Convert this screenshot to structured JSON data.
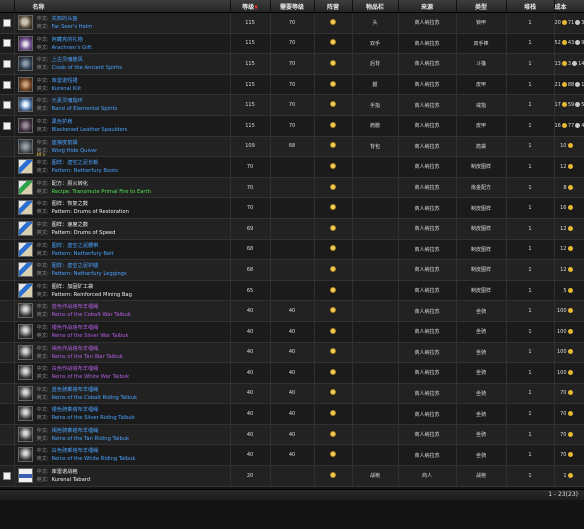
{
  "columns": {
    "name": "名称",
    "level": "等级",
    "req_level": "需要等级",
    "faction": "阵营",
    "slot": "物品栏",
    "source": "来源",
    "type": "类型",
    "stack": "堆栈",
    "cost": "成本"
  },
  "labels": {
    "cn": "中文:",
    "en": "英文:"
  },
  "rows": [
    {
      "icon": "helm",
      "quality": "rare",
      "checkbox": true,
      "cn": "先知的头盔",
      "en": "Far Seer's Helm",
      "level": "115",
      "req": "70",
      "slot": "头",
      "source": "商人纳拉苏",
      "type": "锁甲",
      "stack": "1",
      "cost": {
        "g": "20",
        "s": "71",
        "c": "31"
      }
    },
    {
      "icon": "gift",
      "quality": "rare",
      "checkbox": true,
      "cn": "阿藏克的礼物",
      "en": "Arachnen's Gift",
      "level": "115",
      "req": "70",
      "slot": "双手",
      "source": "商人纳拉苏",
      "type": "双手棒",
      "stack": "1",
      "cost": {
        "g": "52",
        "s": "43",
        "c": "92"
      }
    },
    {
      "icon": "cloak",
      "quality": "rare",
      "checkbox": true,
      "cn": "上古灵魂披风",
      "en": "Cloak of the Ancient Spirits",
      "level": "115",
      "req": "70",
      "slot": "后背",
      "source": "商人纳拉苏",
      "type": "斗篷",
      "stack": "1",
      "cost": {
        "g": "13",
        "s": "3",
        "c": "14"
      }
    },
    {
      "icon": "kilt",
      "quality": "rare",
      "checkbox": true,
      "cn": "库雷诺短裙",
      "en": "Kurenal Kilt",
      "level": "115",
      "req": "70",
      "slot": "腿",
      "source": "商人纳拉苏",
      "type": "皮甲",
      "stack": "1",
      "cost": {
        "g": "21",
        "s": "88",
        "c": "18"
      }
    },
    {
      "icon": "band",
      "quality": "rare",
      "checkbox": true,
      "cn": "元素灵魂指环",
      "en": "Band of Elemental Spirits",
      "level": "115",
      "req": "70",
      "slot": "手指",
      "source": "商人纳拉苏",
      "type": "戒指",
      "stack": "1",
      "cost": {
        "g": "17",
        "s": "59",
        "c": "52"
      }
    },
    {
      "icon": "spauld",
      "quality": "rare",
      "checkbox": true,
      "cn": "黑色护肩",
      "en": "Blackened Leather Spaulders",
      "level": "115",
      "req": "70",
      "slot": "肩膀",
      "source": "商人纳拉苏",
      "type": "皮甲",
      "stack": "1",
      "cost": {
        "g": "16",
        "s": "77",
        "c": "43"
      }
    },
    {
      "icon": "quiver",
      "quality": "rare",
      "checkbox": false,
      "cn": "座狼皮箭袋",
      "en": "Worg Hide Quiver",
      "note": "猎人",
      "level": "109",
      "req": "68",
      "slot": "背包",
      "source": "商人纳拉苏",
      "type": "箭袋",
      "stack": "1",
      "cost": {
        "g": "10",
        "s": "",
        "c": ""
      }
    },
    {
      "icon": "pattern",
      "quality": "rare",
      "checkbox": false,
      "cn": "图样：虚空之泥长靴",
      "en": "Pattern: Netherfury Boots",
      "level": "70",
      "req": "",
      "slot": "",
      "source": "商人纳拉苏",
      "type": "制皮图样",
      "stack": "1",
      "cost": {
        "g": "12",
        "s": "",
        "c": ""
      }
    },
    {
      "icon": "recipe",
      "quality": "green",
      "checkbox": false,
      "cn": "配方：原火转化",
      "en": "Recipe: Transmute Primal Fire to Earth",
      "level": "70",
      "req": "",
      "slot": "",
      "source": "商人纳拉苏",
      "type": "炼金配方",
      "stack": "1",
      "cost": {
        "g": "8",
        "s": "",
        "c": ""
      }
    },
    {
      "icon": "pattern",
      "quality": "white",
      "checkbox": false,
      "cn": "图样：恢复之鼓",
      "en": "Pattern: Drums of Restoration",
      "level": "70",
      "req": "",
      "slot": "",
      "source": "商人纳拉苏",
      "type": "制皮图样",
      "stack": "1",
      "cost": {
        "g": "16",
        "s": "",
        "c": ""
      }
    },
    {
      "icon": "pattern",
      "quality": "white",
      "checkbox": false,
      "cn": "图样：速度之鼓",
      "en": "Pattern: Drums of Speed",
      "level": "69",
      "req": "",
      "slot": "",
      "source": "商人纳拉苏",
      "type": "制皮图样",
      "stack": "1",
      "cost": {
        "g": "12",
        "s": "",
        "c": ""
      }
    },
    {
      "icon": "pattern",
      "quality": "rare",
      "checkbox": false,
      "cn": "图样：虚空之泥腰带",
      "en": "Pattern: Netherfury Belt",
      "level": "68",
      "req": "",
      "slot": "",
      "source": "商人纳拉苏",
      "type": "制皮图样",
      "stack": "1",
      "cost": {
        "g": "12",
        "s": "",
        "c": ""
      }
    },
    {
      "icon": "pattern",
      "quality": "rare",
      "checkbox": false,
      "cn": "图样：虚空之泥护腿",
      "en": "Pattern: Netherfury Leggings",
      "level": "68",
      "req": "",
      "slot": "",
      "source": "商人纳拉苏",
      "type": "制皮图样",
      "stack": "1",
      "cost": {
        "g": "12",
        "s": "",
        "c": ""
      }
    },
    {
      "icon": "pattern",
      "quality": "white",
      "checkbox": false,
      "cn": "图样：加固矿工袋",
      "en": "Pattern: Reinforced Mining Bag",
      "level": "65",
      "req": "",
      "slot": "",
      "source": "商人纳拉苏",
      "type": "制皮图样",
      "stack": "1",
      "cost": {
        "g": "5",
        "s": "",
        "c": ""
      }
    },
    {
      "icon": "mount",
      "quality": "epic",
      "checkbox": false,
      "cn": "蓝色作战塔布羊缰绳",
      "en": "Reins of the Cobalt War Talbuk",
      "level": "40",
      "req": "40",
      "slot": "",
      "source": "商人纳拉苏",
      "type": "坐骑",
      "stack": "1",
      "cost": {
        "g": "100",
        "s": "",
        "c": ""
      }
    },
    {
      "icon": "mount",
      "quality": "epic",
      "checkbox": false,
      "cn": "银色作战塔布羊缰绳",
      "en": "Reins of the Silver War Talbuk",
      "level": "40",
      "req": "40",
      "slot": "",
      "source": "商人纳拉苏",
      "type": "坐骑",
      "stack": "1",
      "cost": {
        "g": "100",
        "s": "",
        "c": ""
      }
    },
    {
      "icon": "mount",
      "quality": "epic",
      "checkbox": false,
      "cn": "褐色作战塔布羊缰绳",
      "en": "Reins of the Tan War Talbuk",
      "level": "40",
      "req": "40",
      "slot": "",
      "source": "商人纳拉苏",
      "type": "坐骑",
      "stack": "1",
      "cost": {
        "g": "100",
        "s": "",
        "c": ""
      }
    },
    {
      "icon": "mount",
      "quality": "epic",
      "checkbox": false,
      "cn": "白色作战塔布羊缰绳",
      "en": "Reins of the White War Talbuk",
      "level": "40",
      "req": "40",
      "slot": "",
      "source": "商人纳拉苏",
      "type": "坐骑",
      "stack": "1",
      "cost": {
        "g": "100",
        "s": "",
        "c": ""
      }
    },
    {
      "icon": "mount",
      "quality": "rare",
      "checkbox": false,
      "cn": "蓝色骑乘塔布羊缰绳",
      "en": "Reins of the Cobalt Riding Talbuk",
      "level": "40",
      "req": "40",
      "slot": "",
      "source": "商人纳拉苏",
      "type": "坐骑",
      "stack": "1",
      "cost": {
        "g": "70",
        "s": "",
        "c": ""
      }
    },
    {
      "icon": "mount",
      "quality": "rare",
      "checkbox": false,
      "cn": "银色骑乘塔布羊缰绳",
      "en": "Reins of the Silver Riding Talbuk",
      "level": "40",
      "req": "40",
      "slot": "",
      "source": "商人纳拉苏",
      "type": "坐骑",
      "stack": "1",
      "cost": {
        "g": "70",
        "s": "",
        "c": ""
      }
    },
    {
      "icon": "mount",
      "quality": "rare",
      "checkbox": false,
      "cn": "褐色骑乘塔布羊缰绳",
      "en": "Reins of the Tan Riding Talbuk",
      "level": "40",
      "req": "40",
      "slot": "",
      "source": "商人纳拉苏",
      "type": "坐骑",
      "stack": "1",
      "cost": {
        "g": "70",
        "s": "",
        "c": ""
      }
    },
    {
      "icon": "mount",
      "quality": "rare",
      "checkbox": false,
      "cn": "白色骑乘塔布羊缰绳",
      "en": "Reins of the White Riding Talbuk",
      "level": "40",
      "req": "40",
      "slot": "",
      "source": "商人纳拉苏",
      "type": "坐骑",
      "stack": "1",
      "cost": {
        "g": "70",
        "s": "",
        "c": ""
      }
    },
    {
      "icon": "tabard",
      "quality": "white",
      "checkbox": true,
      "cn": "库雷诺战袍",
      "en": "Kurenal Tabard",
      "level": "20",
      "req": "",
      "slot": "战袍",
      "source": "商人",
      "type": "战袍",
      "stack": "1",
      "cost": {
        "g": "1",
        "s": "",
        "c": ""
      }
    }
  ],
  "footer": {
    "pagination": "1 - 23(23)"
  },
  "colors": {
    "rare": "#4aa3ff",
    "epic": "#b55fe6",
    "green": "#4fe34f",
    "white": "#f0f0f0",
    "gold": "#e8b830"
  }
}
